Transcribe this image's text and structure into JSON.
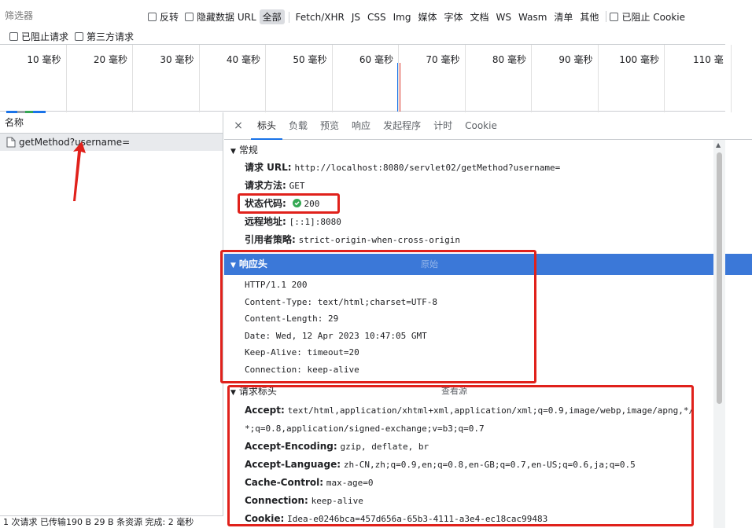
{
  "toolbar": {
    "filter_placeholder": "筛选器",
    "invert_label": "反转",
    "hide_data_url_label": "隐藏数据 URL",
    "types": [
      "全部",
      "Fetch/XHR",
      "JS",
      "CSS",
      "Img",
      "媒体",
      "字体",
      "文档",
      "WS",
      "Wasm",
      "清单",
      "其他"
    ],
    "active_type": "全部",
    "blocked_cookies_label": "已阻止 Cookie",
    "blocked_requests_label": "已阻止请求",
    "third_party_label": "第三方请求"
  },
  "timeline": {
    "ticks": [
      "10 毫秒",
      "20 毫秒",
      "30 毫秒",
      "40 毫秒",
      "50 毫秒",
      "60 毫秒",
      "70 毫秒",
      "80 毫秒",
      "90 毫秒",
      "100 毫秒",
      "110 毫"
    ]
  },
  "request_list": {
    "header": "名称",
    "items": [
      {
        "name": "getMethod?username="
      }
    ],
    "status_text": "1 次请求  已传输190 B  29 B 条资源  完成: 2 毫秒"
  },
  "detail_tabs": {
    "close": "×",
    "tabs": [
      "标头",
      "负载",
      "预览",
      "响应",
      "发起程序",
      "计时",
      "Cookie"
    ],
    "active": "标头"
  },
  "general": {
    "title": "常规",
    "url_label": "请求 URL:",
    "url_value": "http://localhost:8080/servlet02/getMethod?username=",
    "method_label": "请求方法:",
    "method_value": "GET",
    "status_label": "状态代码:",
    "status_value": "200",
    "status_color": "#34a853",
    "remote_label": "远程地址:",
    "remote_value": "[::1]:8080",
    "referrer_label": "引用者策略:",
    "referrer_value": "strict-origin-when-cross-origin"
  },
  "response_headers": {
    "title": "响应头",
    "raw_toggle": "原始",
    "lines": [
      "HTTP/1.1 200",
      "Content-Type: text/html;charset=UTF-8",
      "Content-Length: 29",
      "Date: Wed, 12 Apr 2023 10:47:05 GMT",
      "Keep-Alive: timeout=20",
      "Connection: keep-alive"
    ]
  },
  "request_headers": {
    "title": "请求标头",
    "view_source": "查看源",
    "accept_label": "Accept:",
    "accept_value_1": "text/html,application/xhtml+xml,application/xml;q=0.9,image/webp,image/apng,*/",
    "accept_value_2": "*;q=0.8,application/signed-exchange;v=b3;q=0.7",
    "accept_encoding_label": "Accept-Encoding:",
    "accept_encoding_value": "gzip, deflate, br",
    "accept_language_label": "Accept-Language:",
    "accept_language_value": "zh-CN,zh;q=0.9,en;q=0.8,en-GB;q=0.7,en-US;q=0.6,ja;q=0.5",
    "cache_control_label": "Cache-Control:",
    "cache_control_value": "max-age=0",
    "connection_label": "Connection:",
    "connection_value": "keep-alive",
    "cookie_label": "Cookie:",
    "cookie_value": "Idea-e0246bca=457d656a-65b3-4111-a3e4-ec18cac99483"
  },
  "annotation_color": "#e0211b"
}
